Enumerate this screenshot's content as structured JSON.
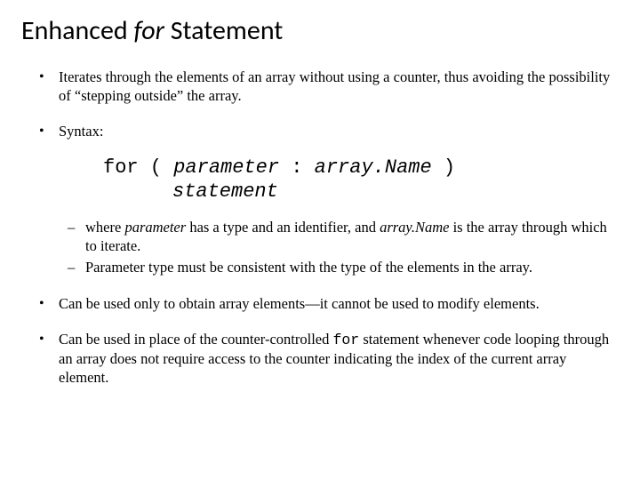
{
  "title": {
    "pre": "Enhanced ",
    "italic": "for",
    "post": " Statement"
  },
  "bullets": {
    "b1": "Iterates through the elements of an array without using a counter, thus avoiding the possibility of “stepping outside” the array.",
    "b2_label": "Syntax:",
    "syntax": {
      "keyword": "for",
      "open": " ( ",
      "param": "parameter",
      "sep": " : ",
      "arr": "array.Name",
      "close": " )",
      "stmt": "statement"
    },
    "sub1_pre": "where ",
    "sub1_param": "parameter",
    "sub1_mid": " has a type and an identifier, and ",
    "sub1_arr": "array.Name",
    "sub1_post": " is the array through which to iterate.",
    "sub2": "Parameter type must be consistent with the type of the elements in the array.",
    "b3": "Can be used only to obtain array elements—it cannot be used to modify elements.",
    "b4_pre": "Can be used in place of the counter-controlled ",
    "b4_for": "for",
    "b4_post": " statement whenever code looping through an array does not require access to the counter indicating the index of the current array element."
  }
}
